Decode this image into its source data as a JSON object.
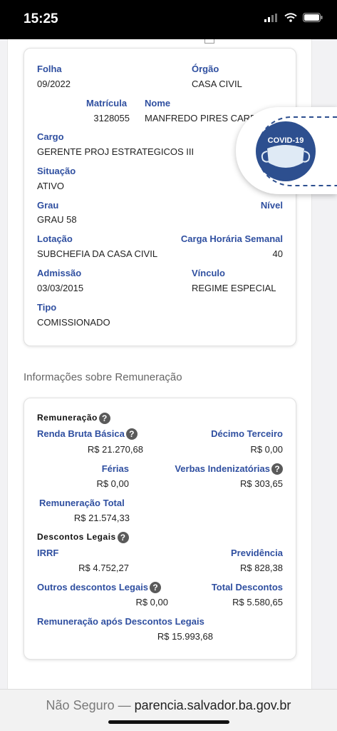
{
  "status_bar": {
    "time": "15:25"
  },
  "employee": {
    "folha_label": "Folha",
    "folha_value": "09/2022",
    "orgao_label": "Órgão",
    "orgao_value": "CASA CIVIL",
    "matricula_label": "Matrícula",
    "matricula_value": "3128055",
    "nome_label": "Nome",
    "nome_value": "MANFREDO PIRES CARDOSO",
    "cargo_label": "Cargo",
    "cargo_value": "GERENTE PROJ ESTRATEGICOS III",
    "situacao_label": "Situação",
    "situacao_value": "ATIVO",
    "grau_label": "Grau",
    "grau_value": "GRAU 58",
    "nivel_label": "Nível",
    "lotacao_label": "Lotação",
    "lotacao_value": "SUBCHEFIA DA CASA CIVIL",
    "carga_label": "Carga Horária Semanal",
    "carga_value": "40",
    "admissao_label": "Admissão",
    "admissao_value": "03/03/2015",
    "vinculo_label": "Vínculo",
    "vinculo_value": "REGIME ESPECIAL",
    "tipo_label": "Tipo",
    "tipo_value": "COMISSIONADO"
  },
  "remuneracao_heading": "Informações sobre Remuneração",
  "remuneracao": {
    "section_title": "Remuneração",
    "renda_label": "Renda Bruta Básica",
    "renda_value": "R$ 21.270,68",
    "decimo_label": "Décimo Terceiro",
    "decimo_value": "R$ 0,00",
    "ferias_label": "Férias",
    "ferias_value": "R$ 0,00",
    "verbas_label": "Verbas Indenizatórias",
    "verbas_value": "R$ 303,65",
    "total_label": "Remuneração Total",
    "total_value": "R$ 21.574,33",
    "descontos_title": "Descontos Legais",
    "irrf_label": "IRRF",
    "irrf_value": "R$ 4.752,27",
    "previdencia_label": "Previdência",
    "previdencia_value": "R$ 828,38",
    "outros_label": "Outros descontos Legais",
    "outros_value": "R$ 0,00",
    "total_descontos_label": "Total Descontos",
    "total_descontos_value": "R$ 5.580,65",
    "apos_label": "Remuneração após Descontos Legais",
    "apos_value": "R$ 15.993,68"
  },
  "covid_badge": {
    "label": "COVID-19"
  },
  "help_glyph": "?",
  "address_bar": {
    "prefix": "Não Seguro — ",
    "url": "parencia.salvador.ba.gov.br"
  },
  "colors": {
    "label_blue": "#2f4fa0",
    "covid_blue": "#2d4f8f"
  }
}
